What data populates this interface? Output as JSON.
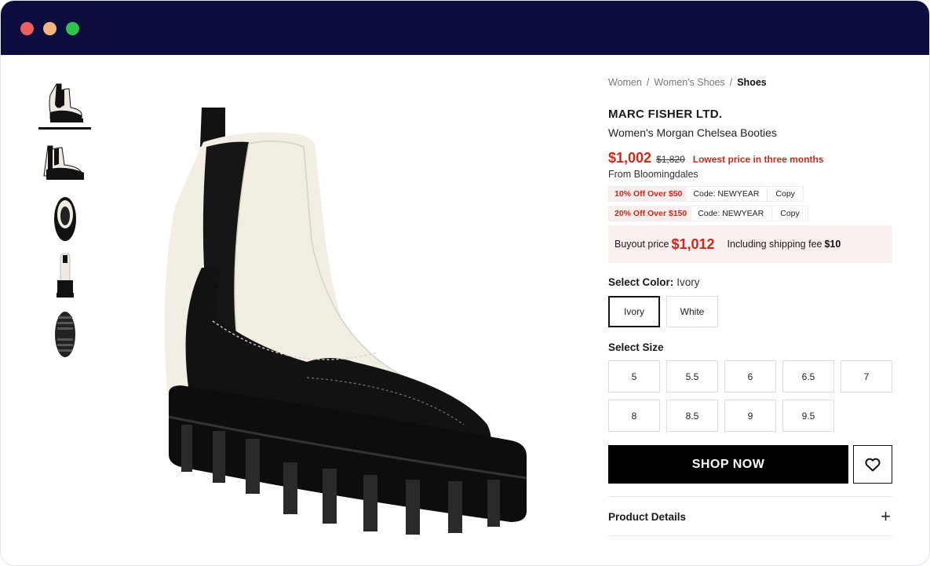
{
  "window": {
    "controls": [
      "close",
      "minimize",
      "maximize"
    ]
  },
  "gallery": {
    "thumbnails": [
      "boot-side-view",
      "boot-side-view-2",
      "boot-top-view",
      "boot-back-view",
      "boot-sole-view"
    ],
    "active_index": 0,
    "main_image": "ivory-black-chelsea-boot"
  },
  "breadcrumb": {
    "items": [
      "Women",
      "Women's Shoes"
    ],
    "current": "Shoes"
  },
  "product": {
    "brand": "MARC FISHER LTD.",
    "name": "Women's Morgan Chelsea Booties",
    "price": "$1,002",
    "original_price": "$1,820",
    "price_note": "Lowest price in three months",
    "from_label": "From",
    "store": "Bloomingdales"
  },
  "coupons": [
    {
      "offer": "10% Off Over $50",
      "code": "Code: NEWYEAR",
      "copy_label": "Copy"
    },
    {
      "offer": "20% Off Over $150",
      "code": "Code: NEWYEAR",
      "copy_label": "Copy"
    }
  ],
  "buyout": {
    "label": "Buyout price",
    "price": "$1,012",
    "shipping_label": "Including shipping fee",
    "shipping_fee": "$10"
  },
  "color": {
    "label": "Select Color:",
    "selected": "Ivory",
    "options": [
      "Ivory",
      "White"
    ]
  },
  "size": {
    "label": "Select Size",
    "options": [
      "5",
      "5.5",
      "6",
      "6.5",
      "7",
      "8",
      "8.5",
      "9",
      "9.5"
    ]
  },
  "actions": {
    "shop_now": "SHOP NOW",
    "wishlist_icon": "heart-icon"
  },
  "details": {
    "label": "Product Details",
    "expand_icon": "plus-icon"
  },
  "colors": {
    "accent_red": "#d4271a",
    "titlebar": "#0c0c3f",
    "promo_bg": "#faf0ef"
  }
}
